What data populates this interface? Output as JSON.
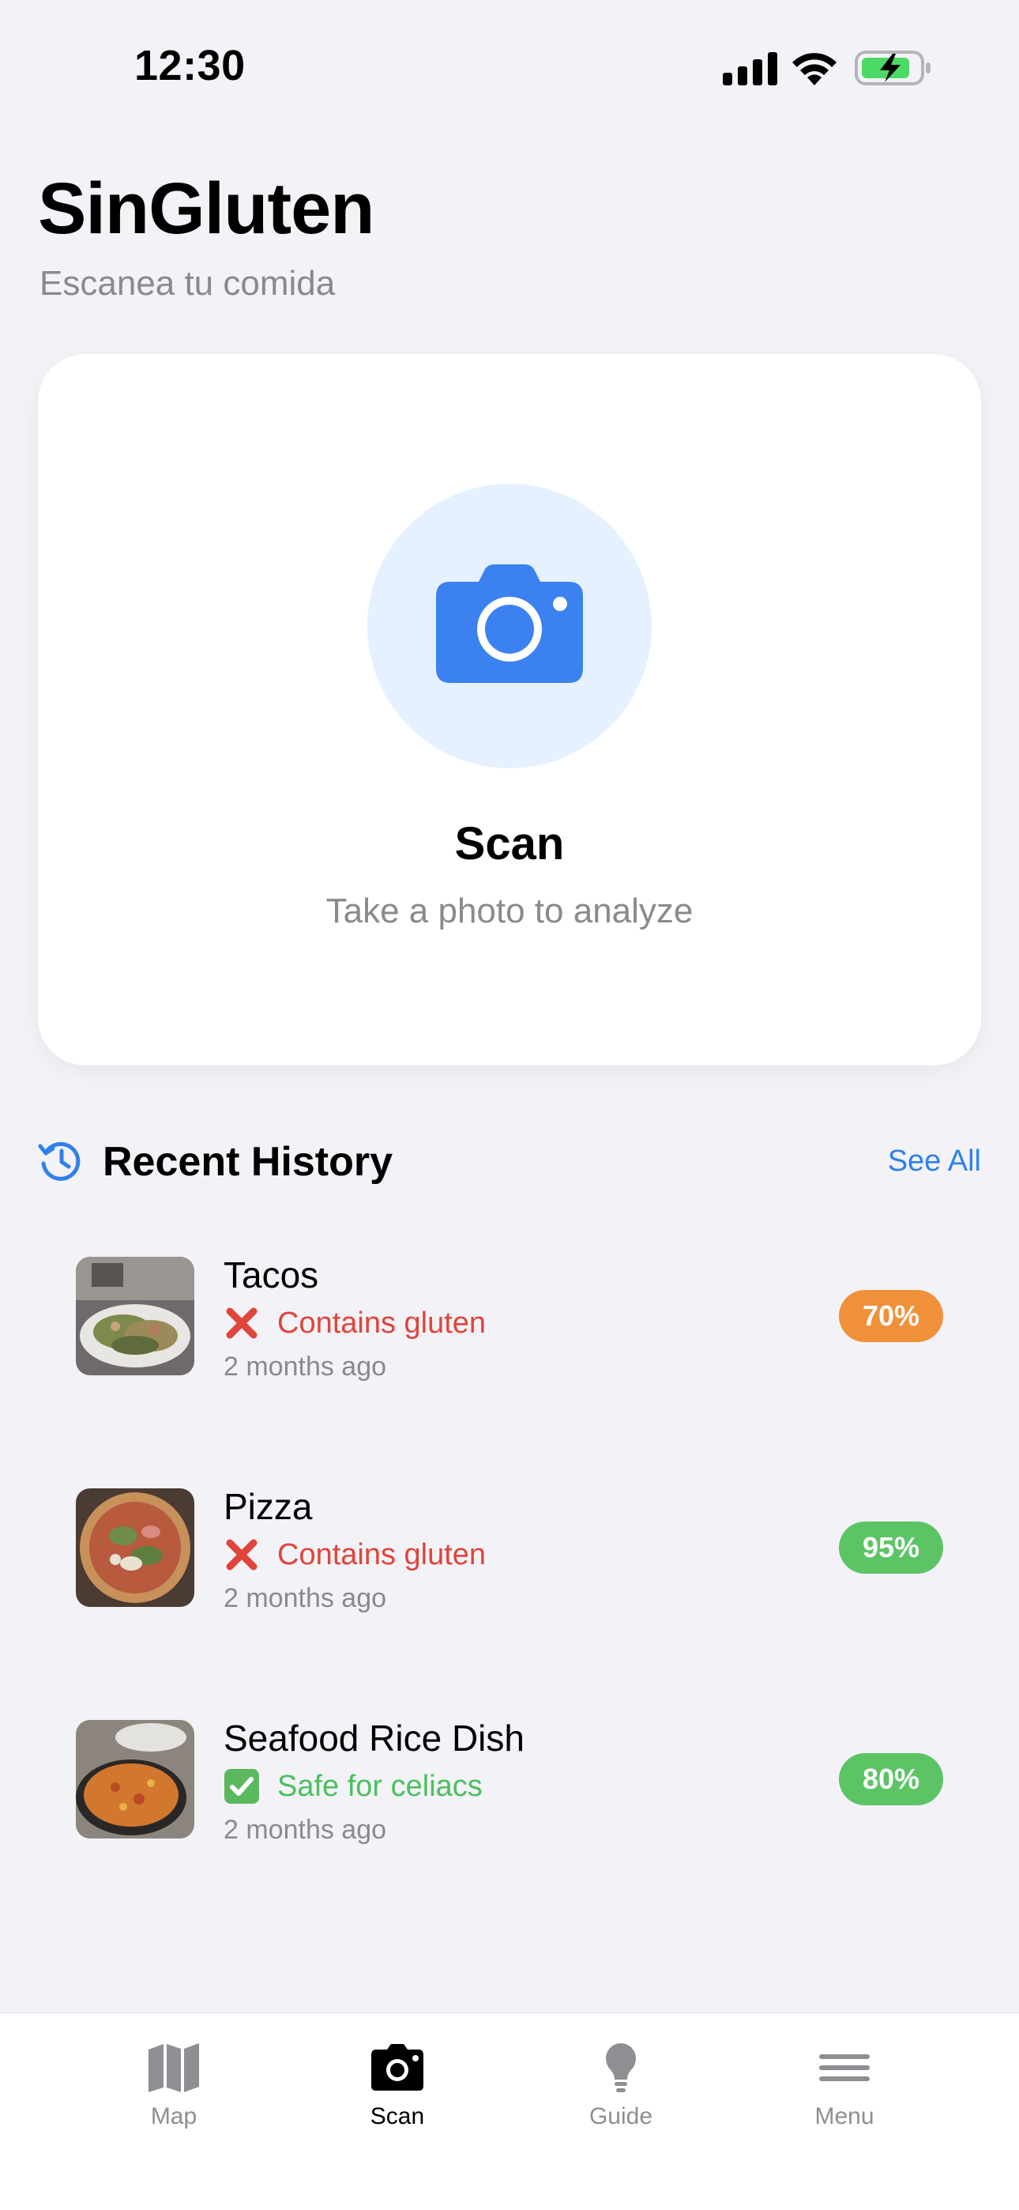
{
  "status_bar": {
    "time": "12:30"
  },
  "header": {
    "title": "SinGluten",
    "subtitle": "Escanea tu comida"
  },
  "scan_card": {
    "title": "Scan",
    "subtitle": "Take a photo to analyze"
  },
  "history": {
    "title": "Recent History",
    "see_all": "See All",
    "items": [
      {
        "name": "Tacos",
        "status": "Contains gluten",
        "status_type": "bad",
        "time": "2 months ago",
        "confidence": "70%",
        "badge_color": "#F0913A"
      },
      {
        "name": "Pizza",
        "status": "Contains gluten",
        "status_type": "bad",
        "time": "2 months ago",
        "confidence": "95%",
        "badge_color": "#5DC466"
      },
      {
        "name": "Seafood Rice Dish",
        "status": "Safe for celiacs",
        "status_type": "good",
        "time": "2 months ago",
        "confidence": "80%",
        "badge_color": "#5DC466"
      }
    ]
  },
  "tab_bar": {
    "tabs": [
      {
        "label": "Map",
        "icon": "map-icon",
        "active": false
      },
      {
        "label": "Scan",
        "icon": "camera-icon",
        "active": true
      },
      {
        "label": "Guide",
        "icon": "lightbulb-icon",
        "active": false
      },
      {
        "label": "Menu",
        "icon": "menu-icon",
        "active": false
      }
    ]
  },
  "colors": {
    "accent": "#2F80ED",
    "camera_blue": "#3B82F0",
    "scan_circle_bg": "#E5F1FE",
    "bad": "#E0443A",
    "good": "#4CBF5E",
    "background": "#F2F2F7"
  }
}
